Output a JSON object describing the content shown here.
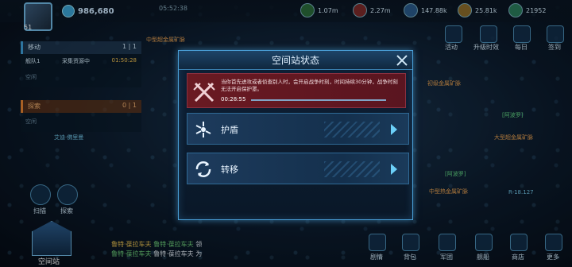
{
  "header": {
    "level": "51",
    "power": "986,680",
    "clock": "05:52:38",
    "resources": [
      {
        "name": "resource-green",
        "value": "1.07m",
        "color": "#5fcf6a"
      },
      {
        "name": "resource-red",
        "value": "2.27m",
        "color": "#e05050"
      },
      {
        "name": "resource-blue",
        "value": "147.88k",
        "color": "#4aa8e0"
      },
      {
        "name": "resource-gold",
        "value": "25.81k",
        "color": "#e8c040"
      },
      {
        "name": "resource-gem",
        "value": "21952",
        "color": "#60d0a0"
      }
    ]
  },
  "left_panel": {
    "move": {
      "label": "移动",
      "count": "1 | 1"
    },
    "fleet_row": {
      "fleet": "舰队1",
      "task": "采集资源中",
      "time": "01:50:28"
    },
    "empty1": "空闲",
    "explore": {
      "label": "探索",
      "count": "0 | 1"
    },
    "empty2": "空闲",
    "buttons": {
      "scan": "扫描",
      "explore": "探索"
    },
    "station": "空间站"
  },
  "top_icons": [
    "活动",
    "升级时效",
    "每日",
    "签到"
  ],
  "bottom_nav": [
    "剧情",
    "背包",
    "军团",
    "舰船",
    "商店",
    "更多"
  ],
  "map_labels": {
    "top": "中型超金属矿脉",
    "right1": "初级金属矿脉",
    "right2": "大型超金属矿脉",
    "right3": "中型热金属矿脉",
    "left1": "艾迪·佛里曼",
    "coords": "R-18.127",
    "fleet1": "[阿波罗]",
    "fleet2": "[阿波罗]"
  },
  "chat": {
    "line1_a": "鲁特·葆拉车夫",
    "line1_b": "鲁特·葆拉车夫",
    "line1_c": "领",
    "line2_a": "鲁特·葆拉车夫",
    "line2_b": "鲁特·葆拉车夫",
    "line2_c": "为"
  },
  "dialog": {
    "title": "空间站状态",
    "warning": "当你首先进攻或者侦查别人时，会开启战争时刻，时间持续30分钟，战争时刻无法开启保护罩。",
    "timer": "00:28:55",
    "options": [
      {
        "label": "护盾",
        "icon": "shield-icon"
      },
      {
        "label": "转移",
        "icon": "relocate-icon"
      }
    ]
  },
  "colors": {
    "accent": "#4aa0d8",
    "warning_bg": "#6a1a22",
    "arrow": "#6cd0f8"
  }
}
